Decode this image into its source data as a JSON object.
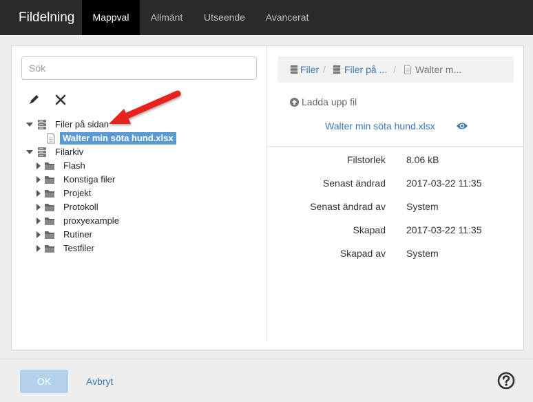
{
  "header": {
    "title": "Fildelning",
    "tabs": [
      {
        "label": "Mappval",
        "active": true
      },
      {
        "label": "Allmänt",
        "active": false
      },
      {
        "label": "Utseende",
        "active": false
      },
      {
        "label": "Avancerat",
        "active": false
      }
    ]
  },
  "search": {
    "placeholder": "Sök",
    "value": ""
  },
  "toolbar": {
    "edit_icon": "pencil-icon",
    "delete_icon": "close-icon"
  },
  "tree": {
    "root1": {
      "label": "Filer på sidan",
      "icon": "server-icon",
      "expanded": true
    },
    "selected_file": {
      "label": "Walter min söta hund.xlsx",
      "icon": "file-icon"
    },
    "root2": {
      "label": "Filarkiv",
      "icon": "server-icon",
      "expanded": true
    },
    "folders": [
      {
        "label": "Flash"
      },
      {
        "label": "Konstiga filer"
      },
      {
        "label": "Projekt"
      },
      {
        "label": "Protokoll"
      },
      {
        "label": "proxyexample"
      },
      {
        "label": "Rutiner"
      },
      {
        "label": "Testfiler"
      }
    ]
  },
  "breadcrumb": {
    "items": [
      "Filer",
      "Filer på ...",
      "Walter m..."
    ],
    "separator": "/"
  },
  "actions": {
    "upload_label": "Ladda upp fil"
  },
  "file": {
    "name": "Walter min söta hund.xlsx"
  },
  "properties": [
    {
      "label": "Filstorlek",
      "value": "8.06 kB"
    },
    {
      "label": "Senast ändrad",
      "value": "2017-03-22 11:35"
    },
    {
      "label": "Senast ändrad av",
      "value": "System"
    },
    {
      "label": "Skapad",
      "value": "2017-03-22 11:35"
    },
    {
      "label": "Skapad av",
      "value": "System"
    }
  ],
  "footer": {
    "ok_label": "OK",
    "cancel_label": "Avbryt",
    "help_icon": "help-icon"
  },
  "colors": {
    "accent": "#3a78b5",
    "selected": "#5b9bd5",
    "topbar": "#2b2b2b",
    "arrow": "#e8231c"
  }
}
